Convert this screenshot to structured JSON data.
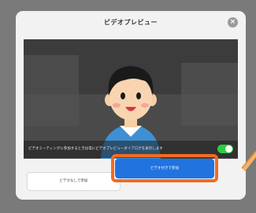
{
  "dialog": {
    "title": "ビデオプレビュー",
    "close_label": "×"
  },
  "preview": {
    "caption": "ビデオミーティングに参加するときは常にビデオプレビューダイアログを表示します"
  },
  "toggle": {
    "state": "on"
  },
  "buttons": {
    "secondary_label": "ビデオなしで参加",
    "primary_label": "ビデオ付きで参加"
  },
  "colors": {
    "primary": "#2173e0",
    "highlight": "#f26b21",
    "toggle_on": "#2ecc40"
  }
}
